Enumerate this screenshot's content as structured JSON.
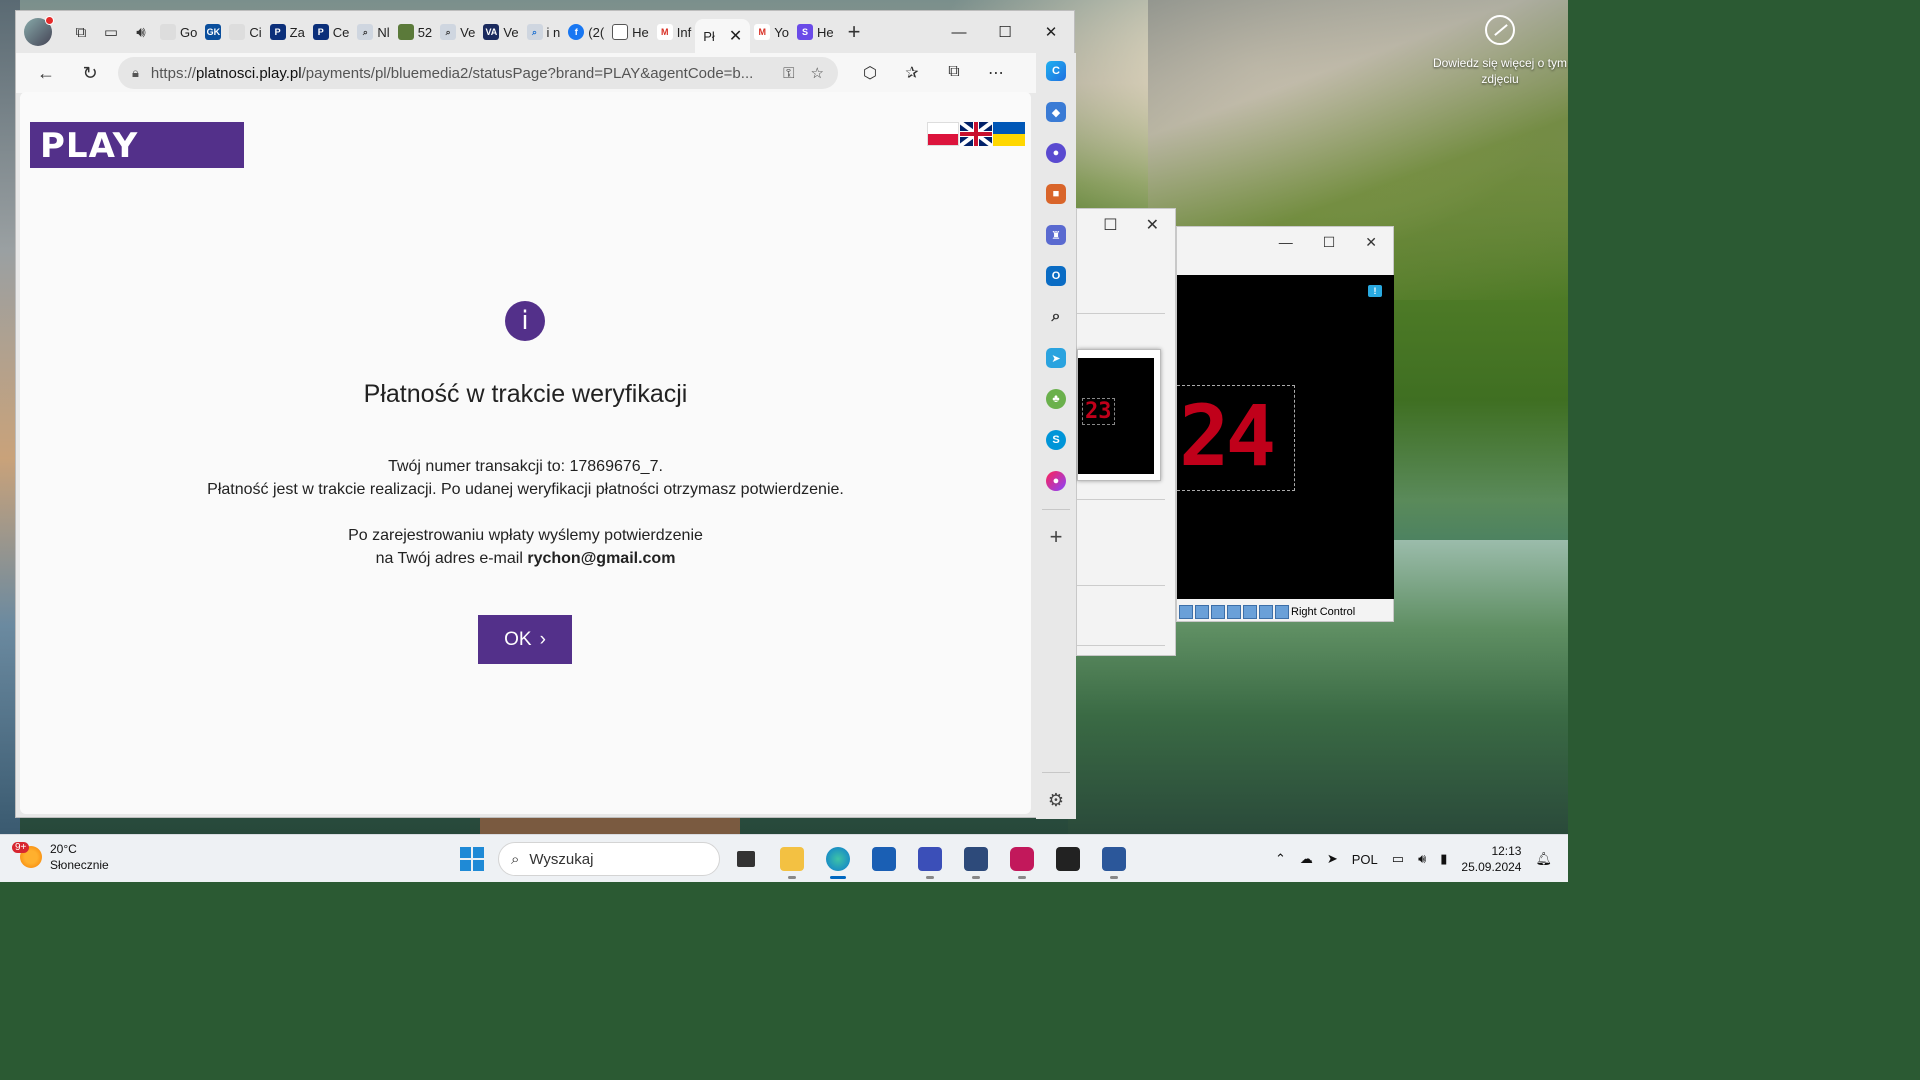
{
  "desktop": {
    "corner_message": "Dowiedz się więcej o tym zdjęciu"
  },
  "browser": {
    "tabs": [
      {
        "label": "Go",
        "icon": "page-icon"
      },
      {
        "label": "GK",
        "icon": "gk-icon"
      },
      {
        "label": "Ci",
        "icon": "page-icon"
      },
      {
        "label": "Za",
        "icon": "paypal-icon"
      },
      {
        "label": "Ce",
        "icon": "paypal-icon"
      },
      {
        "label": "Nl",
        "icon": "search-icon"
      },
      {
        "label": "52",
        "icon": "leaf-icon"
      },
      {
        "label": "Ve",
        "icon": "search-icon"
      },
      {
        "label": "Ve",
        "icon": "va-icon"
      },
      {
        "label": "i n",
        "icon": "search-icon"
      },
      {
        "label": "(2(",
        "icon": "facebook-icon"
      },
      {
        "label": "He",
        "icon": "doc-icon"
      },
      {
        "label": "Inf",
        "icon": "gmail-icon"
      },
      {
        "label": "Pł",
        "icon": "play-icon",
        "active": true
      },
      {
        "label": "Yo",
        "icon": "gmail-icon"
      },
      {
        "label": "He",
        "icon": "s-icon"
      }
    ],
    "address": {
      "prefix": "https://",
      "host": "platnosci.play.pl",
      "path": "/payments/pl/bluemedia2/statusPage?brand=PLAY&agentCode=b..."
    }
  },
  "page": {
    "logo_text": "PLAY",
    "heading": "Płatność w trakcie weryfikacji",
    "transaction_line": "Twój numer transakcji to: 17869676_7.",
    "status_line": "Płatność jest w trakcie realizacji. Po udanej weryfikacji płatności otrzymasz potwierdzenie.",
    "confirm_line1": "Po zarejestrowaniu wpłaty wyślemy potwierdzenie",
    "confirm_line2_prefix": "na Twój adres e-mail",
    "email": "rychon@gmail.com",
    "ok_label": "OK",
    "brand_color": "#53308a"
  },
  "vm": {
    "window1_digits": "23",
    "window2_digits": "24",
    "statusbar_label": "Right Control"
  },
  "taskbar": {
    "weather_badge": "9+",
    "temperature": "20°C",
    "weather_desc": "Słonecznie",
    "search_placeholder": "Wyszukaj",
    "language": "POL",
    "time": "12:13",
    "date": "25.09.2024"
  }
}
